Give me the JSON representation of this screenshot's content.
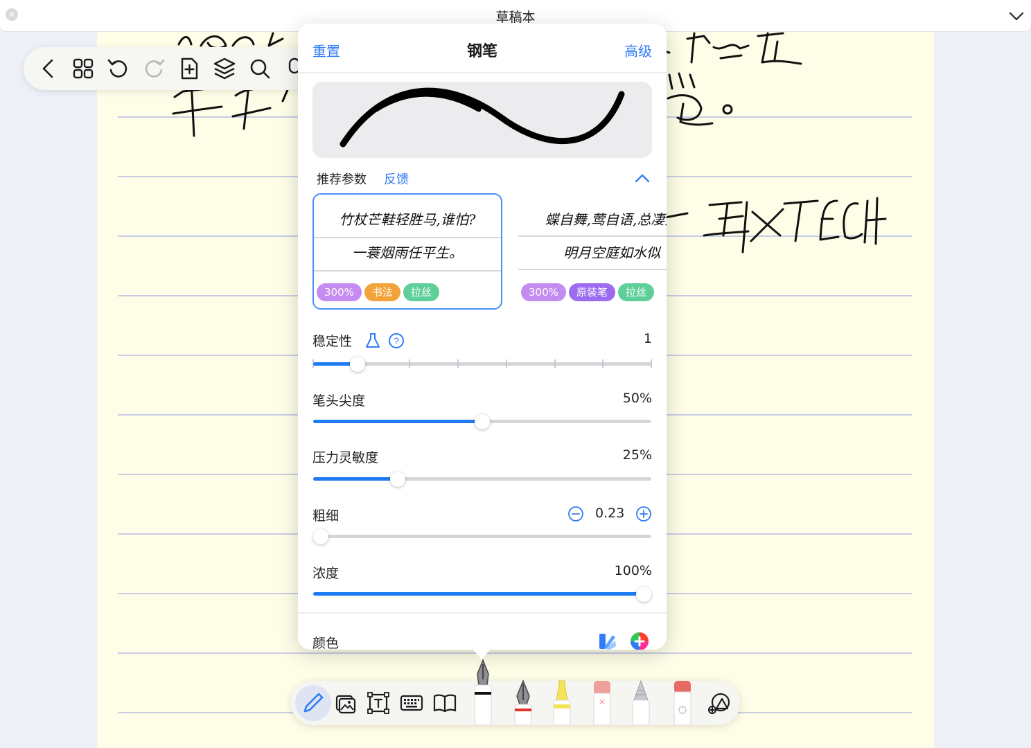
{
  "window": {
    "title": "草稿本"
  },
  "notebook": {
    "handwriting": {
      "line1_left": "1600 lV",
      "line1_right": "、接近",
      "line2_left": "半平",
      "line2_right": "觉。",
      "signature": "—王IXTECH"
    }
  },
  "top_toolbar": {
    "icons": [
      "back-icon",
      "grid-icon",
      "undo-icon",
      "redo-icon",
      "add-page-icon",
      "layers-icon",
      "search-icon",
      "mic-icon"
    ]
  },
  "pen_panel": {
    "reset_label": "重置",
    "title": "钢笔",
    "advanced_label": "高级",
    "recommended_label": "推荐参数",
    "feedback_label": "反馈",
    "presets": [
      {
        "line1": "竹杖芒鞋轻胜马,谁怕?",
        "line2": "一蓑烟雨任平生。",
        "tags": [
          {
            "text": "300%",
            "color": "#c48cf0"
          },
          {
            "text": "书法",
            "color": "#f2a43a"
          },
          {
            "text": "拉丝",
            "color": "#5fcf9a"
          }
        ],
        "selected": true
      },
      {
        "line1": "蝶自舞,莺自语,总凄然",
        "line2": "明月空庭如水似",
        "tags": [
          {
            "text": "300%",
            "color": "#c48cf0"
          },
          {
            "text": "原装笔",
            "color": "#9c6bf0"
          },
          {
            "text": "拉丝",
            "color": "#5fcf9a"
          }
        ],
        "selected": false
      }
    ],
    "params": {
      "stability": {
        "label": "稳定性",
        "value": "1",
        "level": 1,
        "max": 8
      },
      "tip": {
        "label": "笔头尖度",
        "value": "50%",
        "fraction": 0.5
      },
      "pressure": {
        "label": "压力灵敏度",
        "value": "25%",
        "fraction": 0.25
      },
      "thickness": {
        "label": "粗细",
        "value": "0.23",
        "fraction": 0.0
      },
      "opacity": {
        "label": "浓度",
        "value": "100%",
        "fraction": 1.0
      }
    },
    "color_label": "颜色"
  },
  "dock": {
    "mode_icons": [
      "pen-mode-icon",
      "image-icon",
      "text-box-icon",
      "keyboard-icon",
      "book-icon"
    ],
    "tools": [
      "fountain-pen-tool",
      "calligraphy-pen-tool",
      "highlighter-tool",
      "eraser-tool",
      "pencil-tool",
      "lasso-tool"
    ],
    "shapes_icon": "shapes-icon"
  },
  "colors": {
    "accent": "#2f7cf6",
    "paper": "#fefde7",
    "rule": "#c9cde2"
  }
}
